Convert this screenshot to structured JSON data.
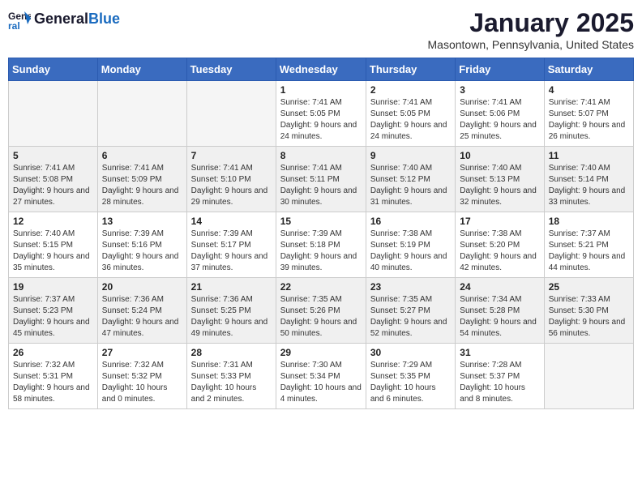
{
  "logo": {
    "line1": "General",
    "line2": "Blue"
  },
  "title": "January 2025",
  "subtitle": "Masontown, Pennsylvania, United States",
  "days_header": [
    "Sunday",
    "Monday",
    "Tuesday",
    "Wednesday",
    "Thursday",
    "Friday",
    "Saturday"
  ],
  "weeks": [
    {
      "shaded": false,
      "cells": [
        {
          "day": "",
          "content": ""
        },
        {
          "day": "",
          "content": ""
        },
        {
          "day": "",
          "content": ""
        },
        {
          "day": "1",
          "content": "Sunrise: 7:41 AM\nSunset: 5:05 PM\nDaylight: 9 hours\nand 24 minutes."
        },
        {
          "day": "2",
          "content": "Sunrise: 7:41 AM\nSunset: 5:05 PM\nDaylight: 9 hours\nand 24 minutes."
        },
        {
          "day": "3",
          "content": "Sunrise: 7:41 AM\nSunset: 5:06 PM\nDaylight: 9 hours\nand 25 minutes."
        },
        {
          "day": "4",
          "content": "Sunrise: 7:41 AM\nSunset: 5:07 PM\nDaylight: 9 hours\nand 26 minutes."
        }
      ]
    },
    {
      "shaded": true,
      "cells": [
        {
          "day": "5",
          "content": "Sunrise: 7:41 AM\nSunset: 5:08 PM\nDaylight: 9 hours\nand 27 minutes."
        },
        {
          "day": "6",
          "content": "Sunrise: 7:41 AM\nSunset: 5:09 PM\nDaylight: 9 hours\nand 28 minutes."
        },
        {
          "day": "7",
          "content": "Sunrise: 7:41 AM\nSunset: 5:10 PM\nDaylight: 9 hours\nand 29 minutes."
        },
        {
          "day": "8",
          "content": "Sunrise: 7:41 AM\nSunset: 5:11 PM\nDaylight: 9 hours\nand 30 minutes."
        },
        {
          "day": "9",
          "content": "Sunrise: 7:40 AM\nSunset: 5:12 PM\nDaylight: 9 hours\nand 31 minutes."
        },
        {
          "day": "10",
          "content": "Sunrise: 7:40 AM\nSunset: 5:13 PM\nDaylight: 9 hours\nand 32 minutes."
        },
        {
          "day": "11",
          "content": "Sunrise: 7:40 AM\nSunset: 5:14 PM\nDaylight: 9 hours\nand 33 minutes."
        }
      ]
    },
    {
      "shaded": false,
      "cells": [
        {
          "day": "12",
          "content": "Sunrise: 7:40 AM\nSunset: 5:15 PM\nDaylight: 9 hours\nand 35 minutes."
        },
        {
          "day": "13",
          "content": "Sunrise: 7:39 AM\nSunset: 5:16 PM\nDaylight: 9 hours\nand 36 minutes."
        },
        {
          "day": "14",
          "content": "Sunrise: 7:39 AM\nSunset: 5:17 PM\nDaylight: 9 hours\nand 37 minutes."
        },
        {
          "day": "15",
          "content": "Sunrise: 7:39 AM\nSunset: 5:18 PM\nDaylight: 9 hours\nand 39 minutes."
        },
        {
          "day": "16",
          "content": "Sunrise: 7:38 AM\nSunset: 5:19 PM\nDaylight: 9 hours\nand 40 minutes."
        },
        {
          "day": "17",
          "content": "Sunrise: 7:38 AM\nSunset: 5:20 PM\nDaylight: 9 hours\nand 42 minutes."
        },
        {
          "day": "18",
          "content": "Sunrise: 7:37 AM\nSunset: 5:21 PM\nDaylight: 9 hours\nand 44 minutes."
        }
      ]
    },
    {
      "shaded": true,
      "cells": [
        {
          "day": "19",
          "content": "Sunrise: 7:37 AM\nSunset: 5:23 PM\nDaylight: 9 hours\nand 45 minutes."
        },
        {
          "day": "20",
          "content": "Sunrise: 7:36 AM\nSunset: 5:24 PM\nDaylight: 9 hours\nand 47 minutes."
        },
        {
          "day": "21",
          "content": "Sunrise: 7:36 AM\nSunset: 5:25 PM\nDaylight: 9 hours\nand 49 minutes."
        },
        {
          "day": "22",
          "content": "Sunrise: 7:35 AM\nSunset: 5:26 PM\nDaylight: 9 hours\nand 50 minutes."
        },
        {
          "day": "23",
          "content": "Sunrise: 7:35 AM\nSunset: 5:27 PM\nDaylight: 9 hours\nand 52 minutes."
        },
        {
          "day": "24",
          "content": "Sunrise: 7:34 AM\nSunset: 5:28 PM\nDaylight: 9 hours\nand 54 minutes."
        },
        {
          "day": "25",
          "content": "Sunrise: 7:33 AM\nSunset: 5:30 PM\nDaylight: 9 hours\nand 56 minutes."
        }
      ]
    },
    {
      "shaded": false,
      "cells": [
        {
          "day": "26",
          "content": "Sunrise: 7:32 AM\nSunset: 5:31 PM\nDaylight: 9 hours\nand 58 minutes."
        },
        {
          "day": "27",
          "content": "Sunrise: 7:32 AM\nSunset: 5:32 PM\nDaylight: 10 hours\nand 0 minutes."
        },
        {
          "day": "28",
          "content": "Sunrise: 7:31 AM\nSunset: 5:33 PM\nDaylight: 10 hours\nand 2 minutes."
        },
        {
          "day": "29",
          "content": "Sunrise: 7:30 AM\nSunset: 5:34 PM\nDaylight: 10 hours\nand 4 minutes."
        },
        {
          "day": "30",
          "content": "Sunrise: 7:29 AM\nSunset: 5:35 PM\nDaylight: 10 hours\nand 6 minutes."
        },
        {
          "day": "31",
          "content": "Sunrise: 7:28 AM\nSunset: 5:37 PM\nDaylight: 10 hours\nand 8 minutes."
        },
        {
          "day": "",
          "content": ""
        }
      ]
    }
  ]
}
